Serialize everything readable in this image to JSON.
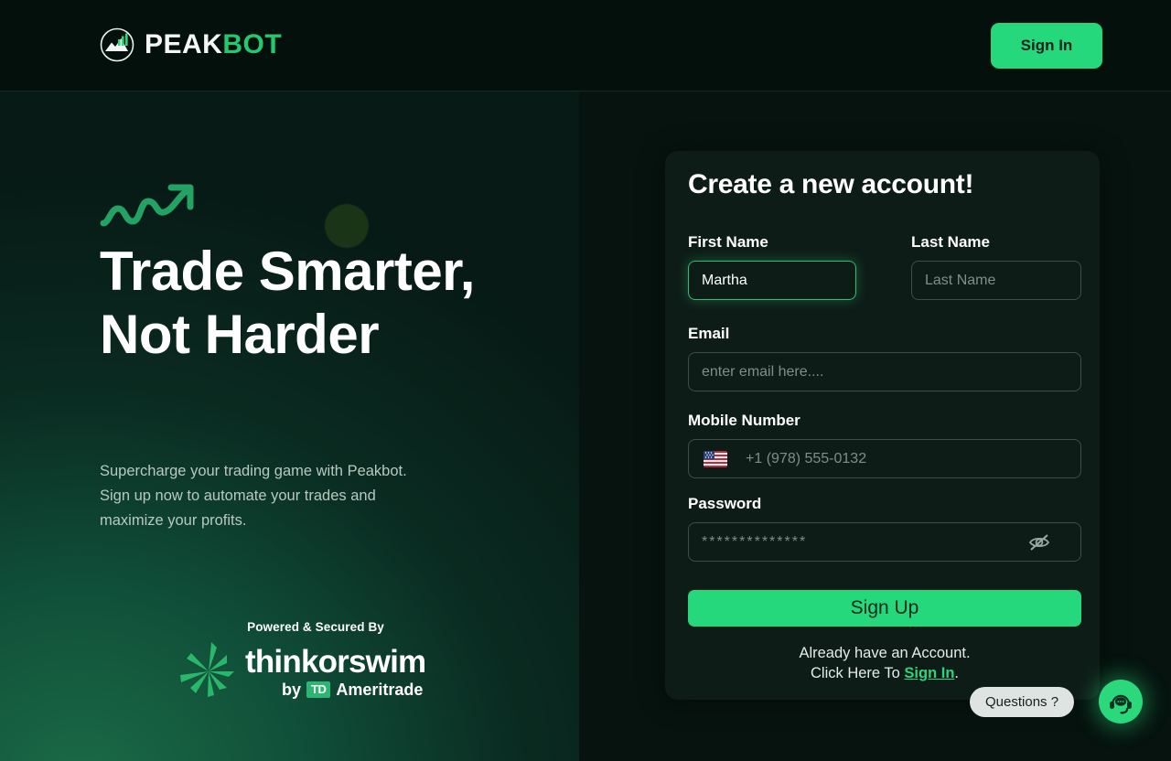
{
  "header": {
    "brand_primary": "PEAK",
    "brand_accent": "BOT",
    "logo_icon": "peak-chart-circle-icon",
    "signin_label": "Sign In"
  },
  "hero": {
    "arrow_icon": "trending-up-arrow-icon",
    "title": "Trade Smarter, Not Harder",
    "subtitle": "Supercharge your trading game with Peakbot. Sign up now to automate your trades and maximize your profits.",
    "partner": {
      "caption": "Powered & Secured By",
      "star_icon": "thinkorswim-starburst-icon",
      "name": "thinkorswim",
      "by": "by",
      "td_badge": "TD",
      "td_name": "Ameritrade"
    }
  },
  "form": {
    "title": "Create a new account!",
    "fields": {
      "first_name": {
        "label": "First Name",
        "value": "Martha",
        "placeholder": "First Name",
        "focused": true
      },
      "last_name": {
        "label": "Last Name",
        "value": "",
        "placeholder": "Last Name",
        "focused": false
      },
      "email": {
        "label": "Email",
        "value": "",
        "placeholder": "enter email here....",
        "focused": false
      },
      "mobile": {
        "label": "Mobile Number",
        "value": "",
        "placeholder": "+1 (978) 555-0132",
        "flag_icon": "us-flag-icon",
        "focused": false
      },
      "password": {
        "label": "Password",
        "value": "",
        "placeholder": "**************",
        "toggle_icon": "eye-off-icon",
        "focused": false
      }
    },
    "submit_label": "Sign Up",
    "footnote_line1": "Already have an Account.",
    "footnote_line2_prefix": "Click Here To ",
    "footnote_link": "Sign In",
    "footnote_line2_suffix": "."
  },
  "support": {
    "pill_label": "Questions ?",
    "fab_icon": "headset-support-icon"
  },
  "colors": {
    "accent_green": "#25d87c",
    "link_green": "#2fd27f",
    "panel_dark": "#06130f",
    "card_bg": "#0e1c17",
    "hero_green": "#10503a"
  }
}
